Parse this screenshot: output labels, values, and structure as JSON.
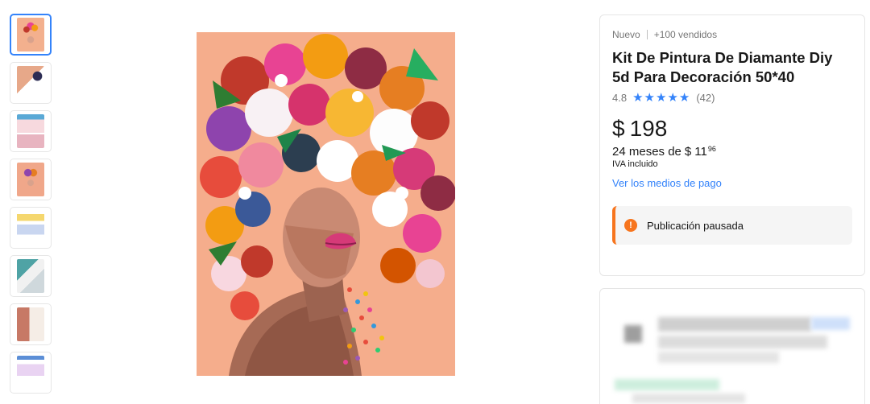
{
  "thumbnails": [
    {
      "alt": "thumbnail-1"
    },
    {
      "alt": "thumbnail-2"
    },
    {
      "alt": "thumbnail-3"
    },
    {
      "alt": "thumbnail-4"
    },
    {
      "alt": "thumbnail-5"
    },
    {
      "alt": "thumbnail-6"
    },
    {
      "alt": "thumbnail-7"
    },
    {
      "alt": "thumbnail-8"
    }
  ],
  "product": {
    "condition": "Nuevo",
    "sold": "+100 vendidos",
    "title": "Kit De Pintura De Diamante Diy 5d Para Decoración 50*40",
    "rating": "4.8",
    "reviews": "(42)",
    "currency": "$",
    "price": "198",
    "installments_prefix": "24 meses de",
    "installment_currency": "$",
    "installment_int": "11",
    "installment_cents": "96",
    "tax_note": "IVA incluido",
    "payment_link": "Ver los medios de pago",
    "status_icon": "!",
    "status_text": "Publicación pausada"
  },
  "colors": {
    "accent": "#3483fa",
    "warning": "#f7751e"
  }
}
